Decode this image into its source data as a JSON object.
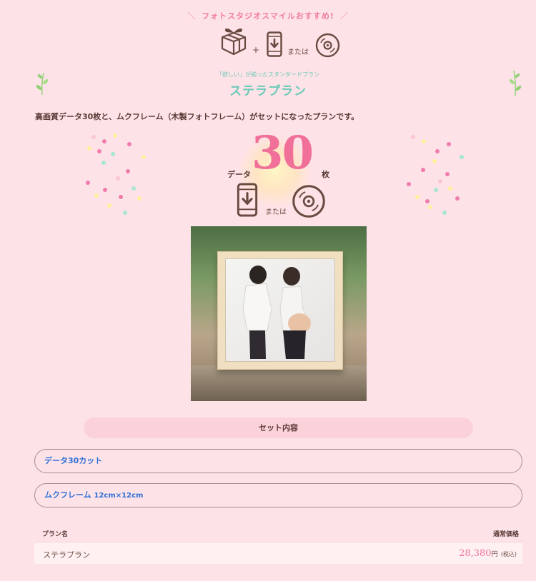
{
  "banner": {
    "text": "フォトスタジオスマイルおすすめ!",
    "left_deco": "＼",
    "right_deco": "／"
  },
  "header_icons": {
    "plus": "+",
    "or_text": "または",
    "icons": [
      "gift-icon",
      "smartphone-download-icon",
      "disc-icon"
    ]
  },
  "plan": {
    "subtitle": "「欲しい」が揃ったスタンダードプラン",
    "title": "ステラプラン",
    "description": "高画質データ30枚と、ムクフレーム（木製フォトフレーム）がセットになったプランです。"
  },
  "highlight": {
    "data_label": "データ",
    "count": "30",
    "unit": "枚",
    "or_text": "または"
  },
  "set_contents": {
    "header": "セット内容",
    "items": [
      {
        "label": "データ30カット",
        "sub": ""
      },
      {
        "label": "ムクフレーム",
        "sub": "12cm×12cm"
      }
    ]
  },
  "price_table": {
    "col_plan": "プラン名",
    "col_price": "通常価格",
    "rows": [
      {
        "name": "ステラプラン",
        "price": "28,380",
        "unit": "円",
        "tax": "(税込)"
      }
    ]
  },
  "colors": {
    "background": "#fde3e7",
    "accent_pink": "#f0709a",
    "accent_teal": "#6cc9b8",
    "link_blue": "#2f6fd8"
  }
}
